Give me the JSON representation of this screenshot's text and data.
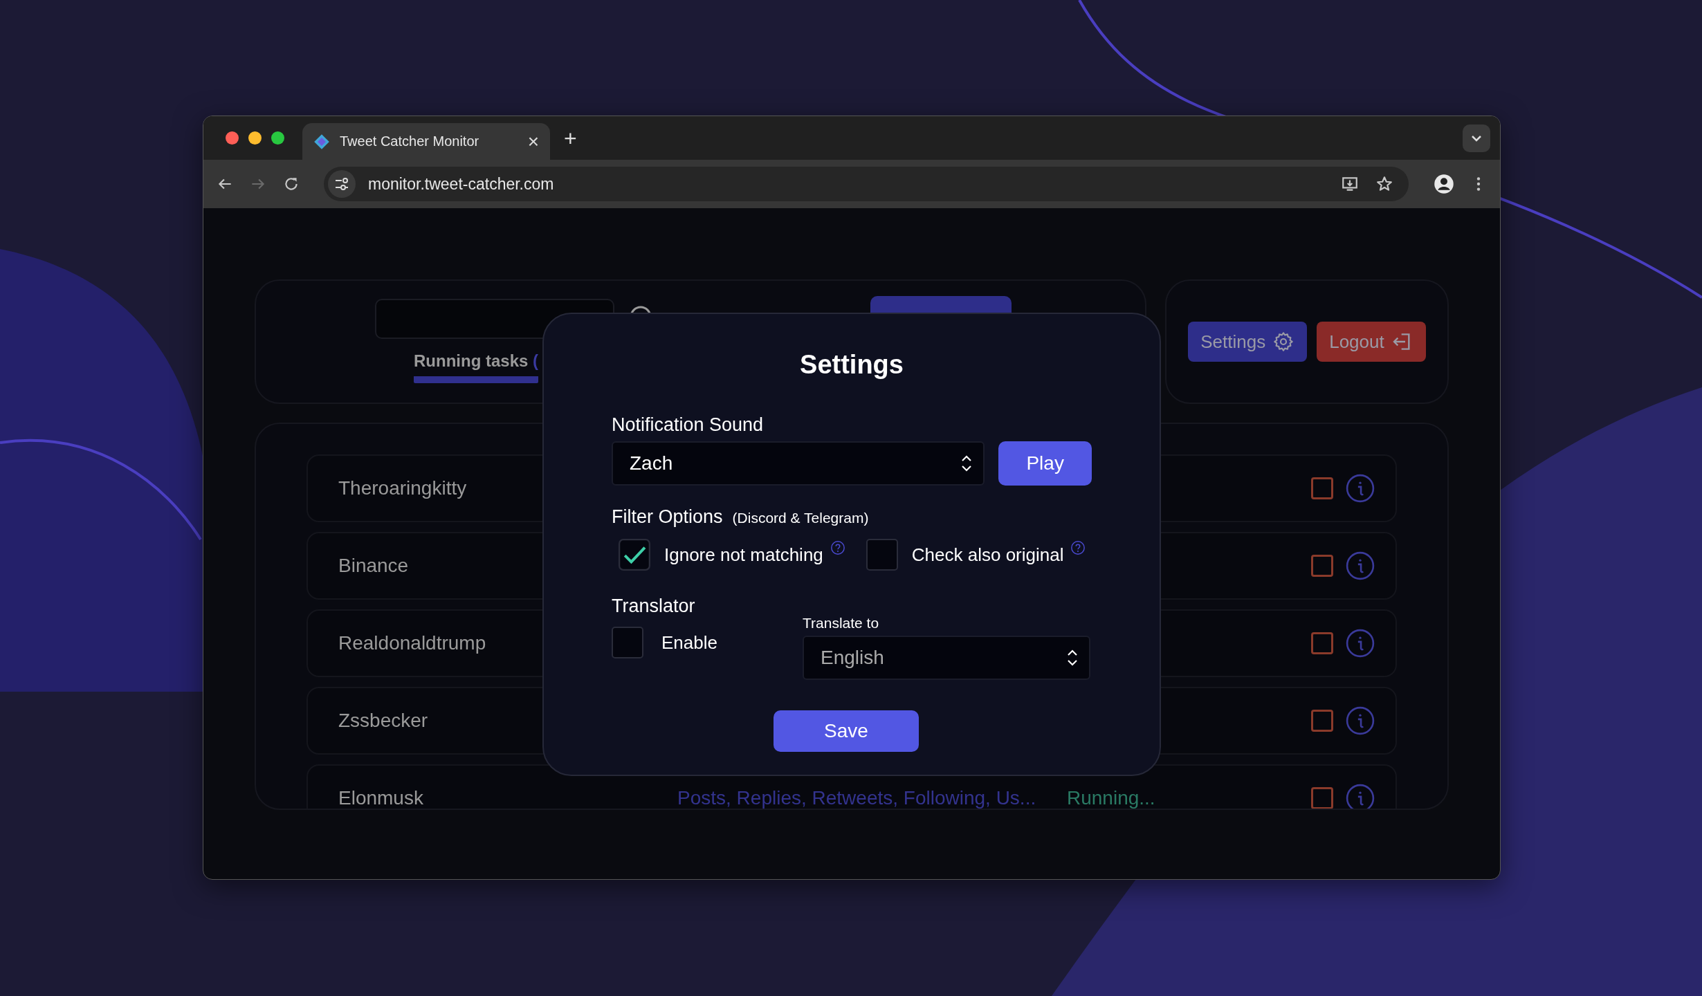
{
  "browser": {
    "tab_title": "Tweet Catcher Monitor",
    "tab_close": "×",
    "new_tab": "+",
    "url": "monitor.tweet-catcher.com"
  },
  "header": {
    "tabs": [
      {
        "label": "Running tasks",
        "suffix": "(",
        "selected": true
      }
    ],
    "buttons": [
      {
        "label": "Settings",
        "kind": "settings"
      },
      {
        "label": "Logout",
        "kind": "logout"
      }
    ]
  },
  "tasks": [
    {
      "name": "Theroaringkitty",
      "checked": false
    },
    {
      "name": "Binance",
      "checked": false
    },
    {
      "name": "Realdonaldtrump",
      "checked": false
    },
    {
      "name": "Zssbecker",
      "checked": false
    },
    {
      "name": "Elonmusk",
      "types": "Posts, Replies, Retweets, Following, Us...",
      "status": "Running...",
      "checked": false
    }
  ],
  "modal": {
    "title": "Settings",
    "notification_sound": {
      "label": "Notification Sound",
      "value": "Zach",
      "button": "Play"
    },
    "filter_options": {
      "label": "Filter Options",
      "note": "(Discord & Telegram)",
      "options": [
        {
          "label": "Ignore not matching",
          "checked": true
        },
        {
          "label": "Check also original",
          "checked": false
        }
      ]
    },
    "translator": {
      "label": "Translator",
      "enable": {
        "label": "Enable",
        "checked": false
      },
      "target_label": "Translate to",
      "target_value": "English"
    },
    "save": "Save"
  }
}
